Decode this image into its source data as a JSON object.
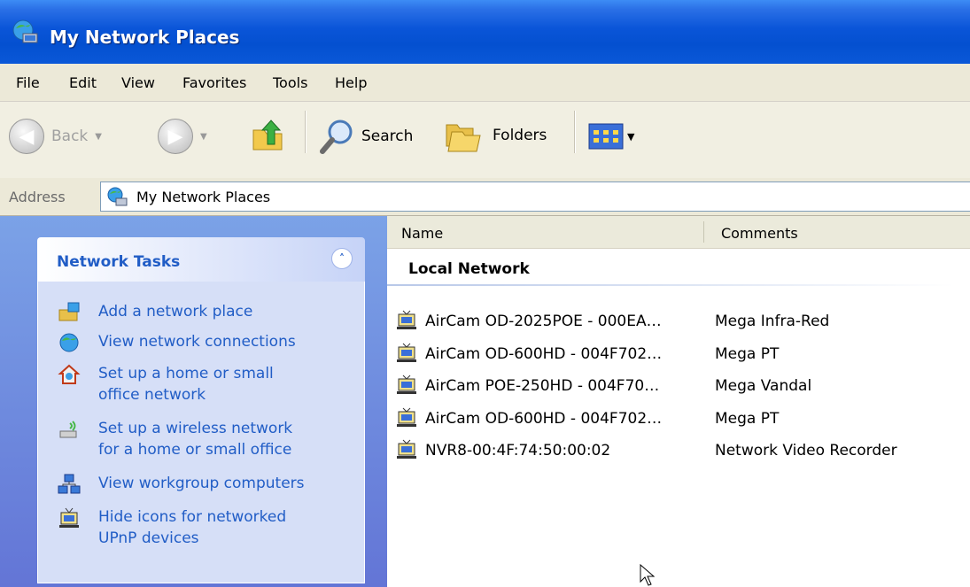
{
  "window": {
    "title": "My Network Places"
  },
  "menu": [
    "File",
    "Edit",
    "View",
    "Favorites",
    "Tools",
    "Help"
  ],
  "toolbar": {
    "back": "Back",
    "search": "Search",
    "folders": "Folders"
  },
  "address": {
    "label": "Address",
    "value": "My Network Places"
  },
  "tasks": {
    "title": "Network Tasks",
    "items": [
      {
        "line1": "Add a network place",
        "line2": ""
      },
      {
        "line1": "View network connections",
        "line2": ""
      },
      {
        "line1": "Set up a home or small",
        "line2": "office network"
      },
      {
        "line1": "Set up a wireless network",
        "line2": "for a home or small office"
      },
      {
        "line1": "View workgroup computers",
        "line2": ""
      },
      {
        "line1": "Hide icons for networked",
        "line2": "UPnP devices"
      }
    ]
  },
  "columns": {
    "name": "Name",
    "comments": "Comments"
  },
  "group": "Local Network",
  "rows": [
    {
      "name": "AirCam OD-2025POE - 000EA…",
      "comment": "Mega Infra-Red"
    },
    {
      "name": "AirCam OD-600HD - 004F702…",
      "comment": "Mega PT"
    },
    {
      "name": "AirCam POE-250HD - 004F70…",
      "comment": "Mega Vandal"
    },
    {
      "name": "AirCam OD-600HD - 004F702…",
      "comment": "Mega PT"
    },
    {
      "name": "NVR8-00:4F:74:50:00:02",
      "comment": "Network Video Recorder"
    }
  ]
}
